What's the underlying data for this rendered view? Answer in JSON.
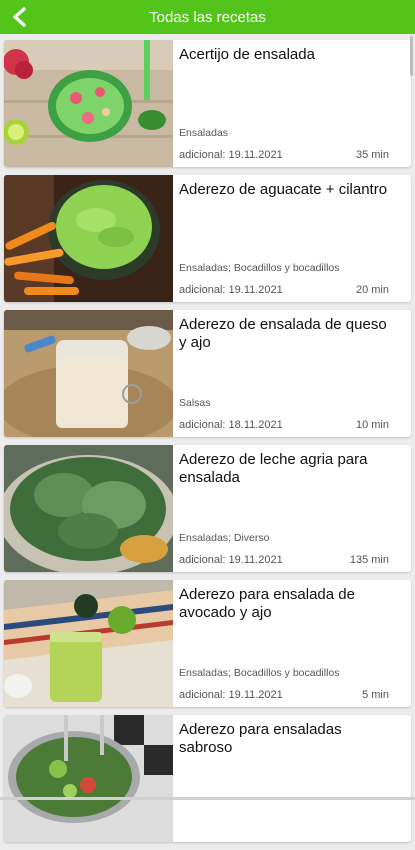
{
  "appbar": {
    "title": "Todas las recetas",
    "back_icon": "arrow-left-icon",
    "color": "#52c41a"
  },
  "recipes": [
    {
      "title": "Acertijo de ensalada",
      "category": "Ensaladas",
      "date": "adicional: 19.11.2021",
      "time": "35 min",
      "image": "salad-bowl-photo"
    },
    {
      "title": "Aderezo de aguacate + cilantro",
      "category": "Ensaladas; Bocadillos y bocadillos",
      "date": "adicional: 19.11.2021",
      "time": "20 min",
      "image": "guacamole-carrots-photo"
    },
    {
      "title": "Aderezo de ensalada de queso y ajo",
      "category": "Salsas",
      "date": "adicional: 18.11.2021",
      "time": "10 min",
      "image": "dressing-jar-photo"
    },
    {
      "title": "Aderezo de leche agria para ensalada",
      "category": "Ensaladas; Diverso",
      "date": "adicional: 19.11.2021",
      "time": "135 min",
      "image": "leafy-greens-photo"
    },
    {
      "title": "Aderezo para ensalada de avocado y ajo",
      "category": "Ensaladas; Bocadillos y bocadillos",
      "date": "adicional: 19.11.2021",
      "time": "5 min",
      "image": "avocado-dressing-photo"
    },
    {
      "title": "Aderezo para ensaladas sabroso",
      "category": "",
      "date": "",
      "time": "",
      "image": "salad-bowl-tongs-photo"
    }
  ]
}
